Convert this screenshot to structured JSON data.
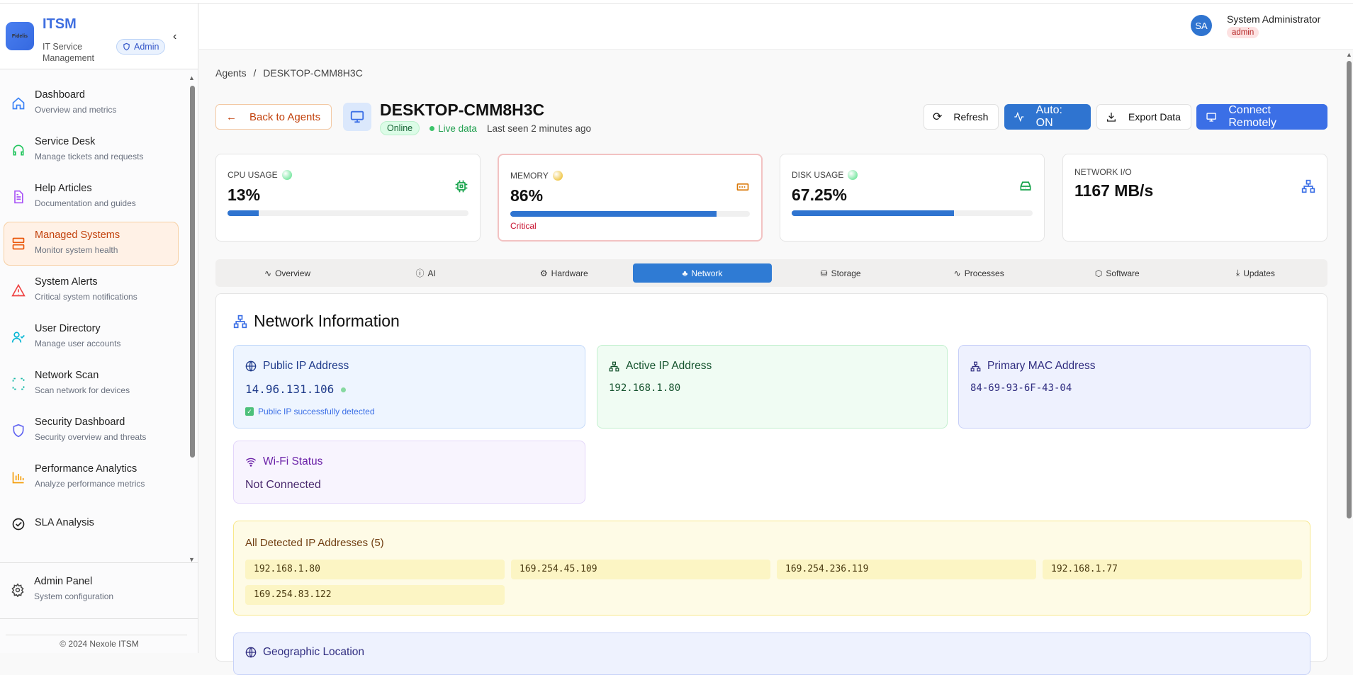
{
  "sidebar": {
    "logo_text": "Fidelis",
    "brand_title": "ITSM",
    "brand_subtitle": "IT Service Management",
    "role_badge": "Admin",
    "items": [
      {
        "title": "Dashboard",
        "subtitle": "Overview and metrics",
        "icon": "home-icon",
        "color": "#3b82f6"
      },
      {
        "title": "Service Desk",
        "subtitle": "Manage tickets and requests",
        "icon": "headset-icon",
        "color": "#22c55e"
      },
      {
        "title": "Help Articles",
        "subtitle": "Documentation and guides",
        "icon": "document-icon",
        "color": "#a855f7"
      },
      {
        "title": "Managed Systems",
        "subtitle": "Monitor system health",
        "icon": "server-icon",
        "color": "#ea580c",
        "active": true
      },
      {
        "title": "System Alerts",
        "subtitle": "Critical system notifications",
        "icon": "alert-triangle-icon",
        "color": "#ef4444"
      },
      {
        "title": "User Directory",
        "subtitle": "Manage user accounts",
        "icon": "user-check-icon",
        "color": "#06b6d4"
      },
      {
        "title": "Network Scan",
        "subtitle": "Scan network for devices",
        "icon": "scan-icon",
        "color": "#14b8a6"
      },
      {
        "title": "Security Dashboard",
        "subtitle": "Security overview and threats",
        "icon": "shield-icon",
        "color": "#6366f1"
      },
      {
        "title": "Performance Analytics",
        "subtitle": "Analyze performance metrics",
        "icon": "bar-chart-icon",
        "color": "#f59e0b"
      },
      {
        "title": "SLA Analysis",
        "subtitle": "",
        "icon": "check-circle-icon",
        "color": "#222222"
      },
      {
        "title": "Automation Center",
        "subtitle": "",
        "icon": "automation-icon",
        "color": "#222222"
      }
    ],
    "footer_item": {
      "title": "Admin Panel",
      "subtitle": "System configuration"
    },
    "copyright": "© 2024 Nexole ITSM"
  },
  "header": {
    "avatar_initials": "SA",
    "user_name": "System Administrator",
    "user_role": "admin"
  },
  "breadcrumb": {
    "parent": "Agents",
    "separator": "/",
    "current": "DESKTOP-CMM8H3C"
  },
  "agent": {
    "back_label": "Back to Agents",
    "hostname": "DESKTOP-CMM8H3C",
    "status": "Online",
    "live_label": "Live data",
    "last_seen": "Last seen 2 minutes ago"
  },
  "toolbar": {
    "refresh": "Refresh",
    "auto": "Auto: ON",
    "export": "Export Data",
    "connect": "Connect Remotely"
  },
  "metrics": [
    {
      "label": "CPU USAGE",
      "value": "13%",
      "percent": 13,
      "dot": "#4ade80",
      "icon_color": "#16a34a"
    },
    {
      "label": "MEMORY",
      "value": "86%",
      "percent": 86,
      "note": "Critical",
      "dot": "#eab308",
      "icon_color": "#d97706"
    },
    {
      "label": "DISK USAGE",
      "value": "67.25%",
      "percent": 67.25,
      "dot": "#4ade80",
      "icon_color": "#16a34a"
    },
    {
      "label": "NETWORK I/O",
      "value": "1167 MB/s",
      "icon_color": "#3b6fe6"
    }
  ],
  "tabs": [
    "Overview",
    "AI",
    "Hardware",
    "Network",
    "Storage",
    "Processes",
    "Software",
    "Updates"
  ],
  "active_tab": "Network",
  "network": {
    "title": "Network Information",
    "public_ip": {
      "label": "Public IP Address",
      "value": "14.96.131.106",
      "note": "Public IP successfully detected"
    },
    "active_ip": {
      "label": "Active IP Address",
      "value": "192.168.1.80"
    },
    "mac": {
      "label": "Primary MAC Address",
      "value": "84-69-93-6F-43-04"
    },
    "wifi": {
      "label": "Wi-Fi Status",
      "value": "Not Connected"
    },
    "all_ips": {
      "label": "All Detected IP Addresses (5)",
      "list": [
        "192.168.1.80",
        "169.254.45.109",
        "169.254.236.119",
        "192.168.1.77",
        "169.254.83.122"
      ]
    },
    "geo": {
      "label": "Geographic Location"
    }
  }
}
